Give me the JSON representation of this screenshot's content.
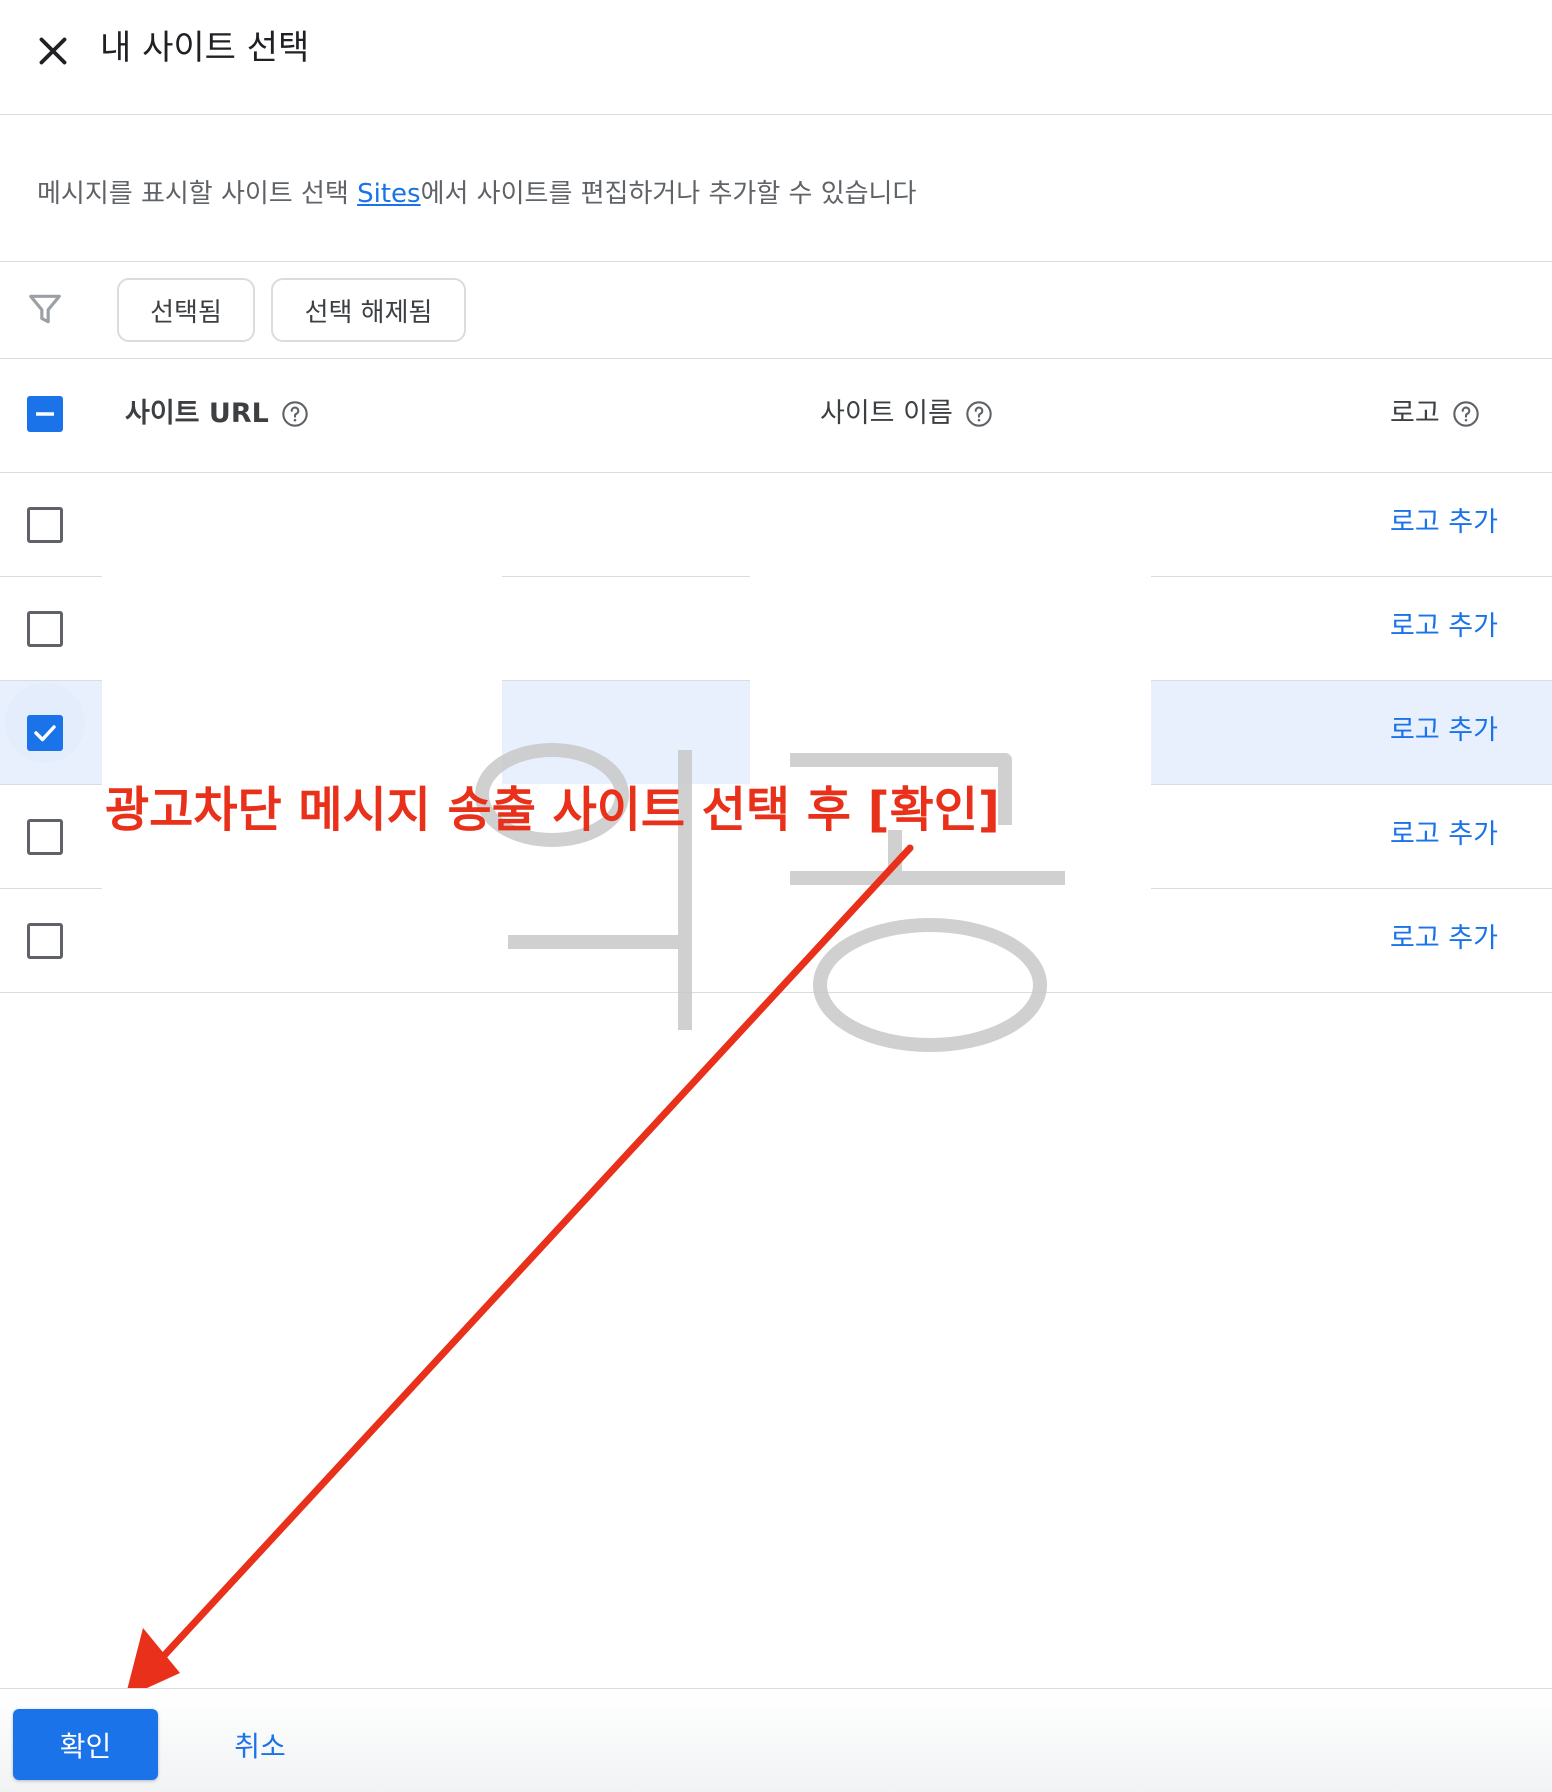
{
  "dialog": {
    "title": "내 사이트 선택",
    "close_icon": "close-icon"
  },
  "description": {
    "before": "메시지를 표시할 사이트 선택 ",
    "link": "Sites",
    "after": "에서 사이트를 편집하거나 추가할 수 있습니다"
  },
  "filters": {
    "icon": "filter-icon",
    "chips": [
      "선택됨",
      "선택 해제됨"
    ]
  },
  "table": {
    "header_checkbox_state": "indeterminate",
    "columns": [
      "사이트 URL",
      "사이트 이름",
      "로고"
    ],
    "rows": [
      {
        "checked": false,
        "site_url": "",
        "site_name": "",
        "logo_action": "로고 추가"
      },
      {
        "checked": false,
        "site_url": "",
        "site_name": "",
        "logo_action": "로고 추가"
      },
      {
        "checked": true,
        "site_url": "",
        "site_name": "",
        "logo_action": "로고 추가"
      },
      {
        "checked": false,
        "site_url": "",
        "site_name": "",
        "logo_action": "로고 추가"
      },
      {
        "checked": false,
        "site_url": "",
        "site_name": "",
        "logo_action": "로고 추가"
      }
    ]
  },
  "annotation": {
    "text": "광고차단 메시지 송출 사이트 선택 후 [확인]",
    "color": "#e8301a"
  },
  "watermark": {
    "text": "악풍"
  },
  "footer": {
    "confirm_label": "확인",
    "cancel_label": "취소"
  },
  "colors": {
    "accent": "#1a73e8",
    "selected_row": "#e8f0fe",
    "annotation": "#e8301a"
  }
}
